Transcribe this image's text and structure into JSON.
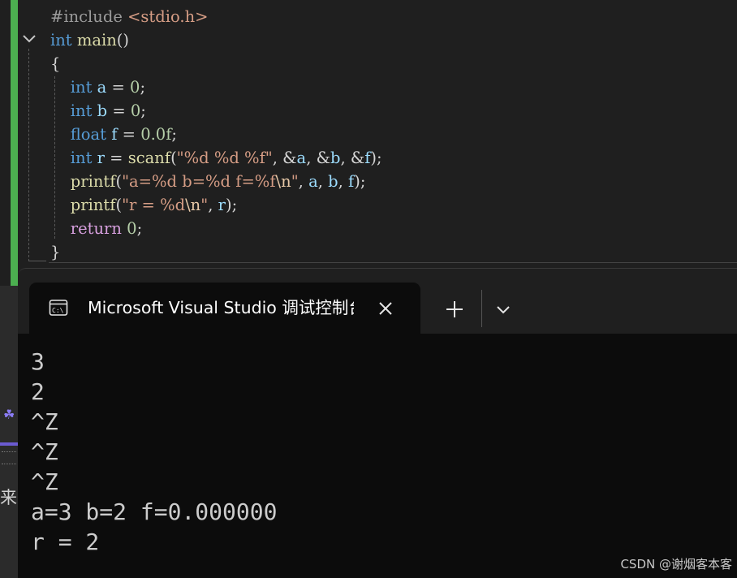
{
  "editor": {
    "lines": [
      {
        "parts": [
          {
            "t": "#include ",
            "c": "pre"
          },
          {
            "t": "<stdio.h>",
            "c": "str"
          }
        ]
      },
      {
        "parts": [
          {
            "t": "int",
            "c": "kw"
          },
          {
            "t": " ",
            "c": "pun"
          },
          {
            "t": "main",
            "c": "fn"
          },
          {
            "t": "()",
            "c": "pun"
          }
        ]
      },
      {
        "parts": [
          {
            "t": "{",
            "c": "pun"
          }
        ]
      },
      {
        "parts": [
          {
            "t": "    ",
            "c": "pun"
          },
          {
            "t": "int",
            "c": "kw"
          },
          {
            "t": " ",
            "c": "pun"
          },
          {
            "t": "a",
            "c": "var"
          },
          {
            "t": " = ",
            "c": "pun"
          },
          {
            "t": "0",
            "c": "num"
          },
          {
            "t": ";",
            "c": "pun"
          }
        ]
      },
      {
        "parts": [
          {
            "t": "    ",
            "c": "pun"
          },
          {
            "t": "int",
            "c": "kw"
          },
          {
            "t": " ",
            "c": "pun"
          },
          {
            "t": "b",
            "c": "var"
          },
          {
            "t": " = ",
            "c": "pun"
          },
          {
            "t": "0",
            "c": "num"
          },
          {
            "t": ";",
            "c": "pun"
          }
        ]
      },
      {
        "parts": [
          {
            "t": "    ",
            "c": "pun"
          },
          {
            "t": "float",
            "c": "kw"
          },
          {
            "t": " ",
            "c": "pun"
          },
          {
            "t": "f",
            "c": "var"
          },
          {
            "t": " = ",
            "c": "pun"
          },
          {
            "t": "0.0f",
            "c": "num"
          },
          {
            "t": ";",
            "c": "pun"
          }
        ]
      },
      {
        "parts": [
          {
            "t": "    ",
            "c": "pun"
          },
          {
            "t": "int",
            "c": "kw"
          },
          {
            "t": " ",
            "c": "pun"
          },
          {
            "t": "r",
            "c": "var"
          },
          {
            "t": " = ",
            "c": "pun"
          },
          {
            "t": "scanf",
            "c": "fn"
          },
          {
            "t": "(",
            "c": "pun"
          },
          {
            "t": "\"%d %d %f\"",
            "c": "str"
          },
          {
            "t": ", &",
            "c": "pun"
          },
          {
            "t": "a",
            "c": "var"
          },
          {
            "t": ", &",
            "c": "pun"
          },
          {
            "t": "b",
            "c": "var"
          },
          {
            "t": ", &",
            "c": "pun"
          },
          {
            "t": "f",
            "c": "var"
          },
          {
            "t": ");",
            "c": "pun"
          }
        ]
      },
      {
        "parts": [
          {
            "t": "    ",
            "c": "pun"
          },
          {
            "t": "printf",
            "c": "fn"
          },
          {
            "t": "(",
            "c": "pun"
          },
          {
            "t": "\"a=%d b=%d f=%f",
            "c": "str"
          },
          {
            "t": "\\n",
            "c": "esc"
          },
          {
            "t": "\"",
            "c": "str"
          },
          {
            "t": ", ",
            "c": "pun"
          },
          {
            "t": "a",
            "c": "var"
          },
          {
            "t": ", ",
            "c": "pun"
          },
          {
            "t": "b",
            "c": "var"
          },
          {
            "t": ", ",
            "c": "pun"
          },
          {
            "t": "f",
            "c": "var"
          },
          {
            "t": ");",
            "c": "pun"
          }
        ]
      },
      {
        "parts": [
          {
            "t": "    ",
            "c": "pun"
          },
          {
            "t": "printf",
            "c": "fn"
          },
          {
            "t": "(",
            "c": "pun"
          },
          {
            "t": "\"r = %d",
            "c": "str"
          },
          {
            "t": "\\n",
            "c": "esc"
          },
          {
            "t": "\"",
            "c": "str"
          },
          {
            "t": ", ",
            "c": "pun"
          },
          {
            "t": "r",
            "c": "var"
          },
          {
            "t": ");",
            "c": "pun"
          }
        ]
      },
      {
        "parts": [
          {
            "t": "    ",
            "c": "pun"
          },
          {
            "t": "return",
            "c": "ctl"
          },
          {
            "t": " ",
            "c": "pun"
          },
          {
            "t": "0",
            "c": "num"
          },
          {
            "t": ";",
            "c": "pun"
          }
        ]
      },
      {
        "parts": [
          {
            "t": "}",
            "c": "pun"
          }
        ]
      }
    ],
    "change_bar_color": "#4caf50",
    "fold_icon": "chevron-down-icon"
  },
  "terminal": {
    "tab_title": "Microsoft Visual Studio 调试控制台",
    "tab_icon": "console-icon",
    "close_icon": "close-icon",
    "new_tab_icon": "plus-icon",
    "dropdown_icon": "chevron-down-icon",
    "output": [
      "3",
      "2",
      "^Z",
      "^Z",
      "^Z",
      "a=3 b=2 f=0.000000",
      "r = 2"
    ]
  },
  "left_strip": {
    "glyph": "来"
  },
  "watermark": "CSDN @谢烟客本客"
}
